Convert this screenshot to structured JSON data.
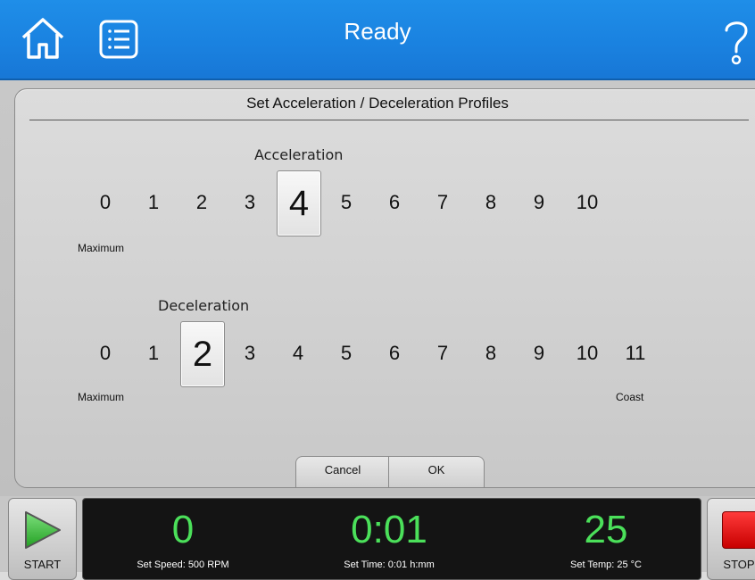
{
  "header": {
    "title": "Ready",
    "home_icon": "home-icon",
    "list_icon": "list-icon",
    "help_icon": "help-icon",
    "color": "#1a82e0"
  },
  "dialog": {
    "title": "Set Acceleration / Deceleration Profiles",
    "acceleration": {
      "label": "Acceleration",
      "options": [
        "0",
        "1",
        "2",
        "3",
        "4",
        "5",
        "6",
        "7",
        "8",
        "9",
        "10"
      ],
      "selected": "4",
      "min_label": "Maximum"
    },
    "deceleration": {
      "label": "Deceleration",
      "options": [
        "0",
        "1",
        "2",
        "3",
        "4",
        "5",
        "6",
        "7",
        "8",
        "9",
        "10",
        "11"
      ],
      "selected": "2",
      "min_label": "Maximum",
      "max_label": "Coast"
    },
    "cancel_label": "Cancel",
    "ok_label": "OK"
  },
  "footer": {
    "start_label": "START",
    "stop_label": "STOP",
    "speed": {
      "value": "0",
      "label": "Set Speed: 500 RPM"
    },
    "time": {
      "value": "0:01",
      "label": "Set Time: 0:01 h:mm"
    },
    "temp": {
      "value": "25",
      "label": "Set Temp: 25 °C"
    },
    "readout_color": "#4be05a",
    "stop_color": "#e01010",
    "start_color": "#3fbf3f"
  }
}
